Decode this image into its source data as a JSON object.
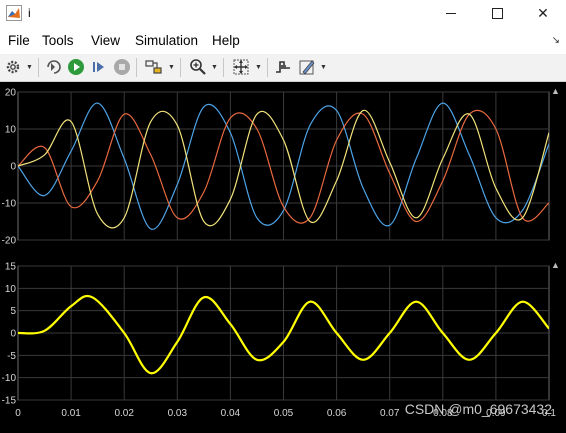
{
  "window": {
    "title": "i"
  },
  "menu": [
    "File",
    "Tools",
    "View",
    "Simulation",
    "Help"
  ],
  "watermark": "CSDN @m0_69673432",
  "plot_top": {
    "ylim": [
      -20,
      20
    ],
    "yticks": [
      "20",
      "10",
      "0",
      "-10",
      "-20"
    ],
    "series_colors": [
      "#4da3e6",
      "#e8693f",
      "#f2e27a"
    ]
  },
  "plot_bottom": {
    "ylim": [
      -15,
      15
    ],
    "yticks": [
      "15",
      "10",
      "5",
      "0",
      "-5",
      "-10",
      "-15"
    ],
    "xticks": [
      "0",
      "0.01",
      "0.02",
      "0.03",
      "0.04",
      "0.05",
      "0.06",
      "0.07",
      "0.08",
      "0.09",
      "0.1"
    ],
    "series_color": "#ffff00"
  },
  "chart_data": [
    {
      "type": "line",
      "xlim": [
        0,
        0.1
      ],
      "ylim": [
        -20,
        20
      ],
      "series": [
        {
          "color": "#4da3e6",
          "x": [
            0,
            0.005,
            0.01,
            0.015,
            0.02,
            0.025,
            0.03,
            0.035,
            0.04,
            0.045,
            0.05,
            0.055,
            0.06,
            0.065,
            0.07,
            0.075,
            0.08,
            0.085,
            0.09,
            0.095,
            0.1
          ],
          "y": [
            0,
            -8,
            4,
            17,
            2,
            -17,
            -5,
            16,
            9,
            -14,
            -12,
            11,
            15,
            -6,
            -16,
            2,
            17,
            3,
            -14,
            -12,
            6
          ]
        },
        {
          "color": "#e8693f",
          "x": [
            0,
            0.005,
            0.01,
            0.015,
            0.02,
            0.025,
            0.03,
            0.035,
            0.04,
            0.045,
            0.05,
            0.055,
            0.06,
            0.065,
            0.07,
            0.075,
            0.08,
            0.085,
            0.09,
            0.095,
            0.1
          ],
          "y": [
            0,
            5,
            -11,
            -4,
            14,
            3,
            -14,
            -7,
            13,
            10,
            -11,
            -14,
            7,
            14,
            -2,
            -15,
            -4,
            14,
            10,
            -14,
            -10
          ]
        },
        {
          "color": "#f2e27a",
          "x": [
            0,
            0.005,
            0.01,
            0.015,
            0.02,
            0.025,
            0.03,
            0.035,
            0.04,
            0.045,
            0.05,
            0.055,
            0.06,
            0.065,
            0.07,
            0.075,
            0.08,
            0.085,
            0.09,
            0.095,
            0.1
          ],
          "y": [
            0,
            3,
            12,
            -13,
            -14,
            12,
            11,
            -15,
            -9,
            14,
            7,
            -15,
            -4,
            15,
            1,
            -14,
            2,
            14,
            -6,
            -14,
            9
          ]
        }
      ]
    },
    {
      "type": "line",
      "xlim": [
        0,
        0.1
      ],
      "ylim": [
        -15,
        15
      ],
      "series": [
        {
          "color": "#ffff00",
          "x": [
            0,
            0.005,
            0.01,
            0.014,
            0.02,
            0.025,
            0.03,
            0.035,
            0.04,
            0.045,
            0.05,
            0.055,
            0.06,
            0.065,
            0.07,
            0.075,
            0.08,
            0.085,
            0.09,
            0.095,
            0.1
          ],
          "y": [
            0,
            0.5,
            6,
            8,
            0,
            -9,
            -2,
            8,
            2,
            -6,
            -2,
            7,
            0,
            -6,
            0,
            7,
            0,
            -6,
            0,
            7,
            1
          ]
        }
      ]
    }
  ]
}
